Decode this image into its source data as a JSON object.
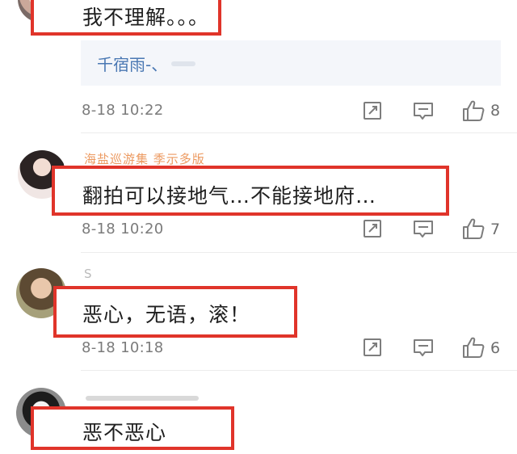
{
  "comments": [
    {
      "content": "我不理解。。。",
      "quote": "千宿雨-、",
      "time": "8-18 10:22",
      "likes": "8",
      "highlight_color": "#e0342a"
    },
    {
      "username": "海盐巡游集 季示多版",
      "content": "翻拍可以接地气…不能接地府…",
      "time": "8-18 10:20",
      "likes": "7",
      "username_color": "#e8813a"
    },
    {
      "username": "S",
      "content": "恶心，无语，滚！",
      "time": "8-18 10:18",
      "likes": "6"
    },
    {
      "content": "恶不恶心"
    }
  ],
  "icons": {
    "share": "share-icon",
    "comment": "comment-icon",
    "like": "thumbs-up-icon"
  }
}
